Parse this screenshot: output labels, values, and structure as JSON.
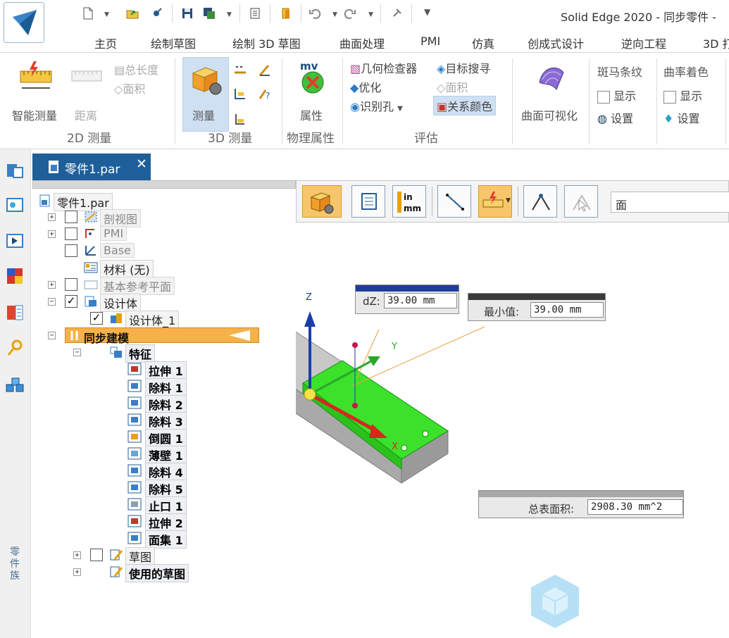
{
  "window": {
    "title": "Solid Edge 2020 - 同步零件 -"
  },
  "menu_tabs": [
    "主页",
    "绘制草图",
    "绘制 3D 草图",
    "曲面处理",
    "PMI",
    "仿真",
    "创成式设计",
    "逆向工程",
    "3D 打"
  ],
  "ribbon": {
    "smart_measure": "智能测量",
    "distance": "距离",
    "total_length": "总长度",
    "area_2d": "面积",
    "group_2d": "2D 测量",
    "measure": "测量",
    "group_3d": "3D 测量",
    "properties": "属性",
    "group_physical": "物理属性",
    "geometry_inspector": "几何检查器",
    "target_search": "目标搜寻",
    "optimize": "优化",
    "area_eval": "面积",
    "recognize_holes": "识别孔",
    "relation_colors": "关系颜色",
    "group_evaluate": "评估",
    "surface_visualization": "曲面可视化",
    "zebra_stripes": "斑马条纹",
    "zebra_show": "显示",
    "zebra_settings": "设置",
    "curvature_shading": "曲率着色",
    "curv_show": "显示",
    "curv_settings": "设置"
  },
  "left_toolbar": {
    "part_family": "零件族"
  },
  "doc_tab": {
    "label": "零件1.par",
    "close": "✕"
  },
  "tree": {
    "root": "零件1.par",
    "section_view": "剖视图",
    "pmi": "PMI",
    "base": "Base",
    "material": "材料 (无)",
    "base_ref_planes": "基本参考平面",
    "design_body": "设计体",
    "design_body_1": "设计体_1",
    "sync_modeling": "同步建模",
    "features": "特征",
    "feature_items": [
      "拉伸 1",
      "除料 1",
      "除料 2",
      "除料 3",
      "倒圆 1",
      "薄壁 1",
      "除料 4",
      "除料 5",
      "止口 1",
      "拉伸 2",
      "面集 1"
    ],
    "sketches": "草图",
    "used_sketches": "使用的草图"
  },
  "command_bar": {
    "face_field": "面"
  },
  "viewport": {
    "axis_z": "Z",
    "axis_y": "Y",
    "axis_x": "X",
    "dz_label": "dZ:",
    "dz_value": "39.00 mm",
    "min_label": "最小值:",
    "min_value": "39.00 mm",
    "area_label": "总表面积:",
    "area_value": "2908.30 mm^2"
  },
  "colors": {
    "doc_tab_bg": "#1e5f9a",
    "selected_face": "#3be12a",
    "sync_highlight": "#f6b14a",
    "ribbon_active": "#cfe0f3"
  }
}
